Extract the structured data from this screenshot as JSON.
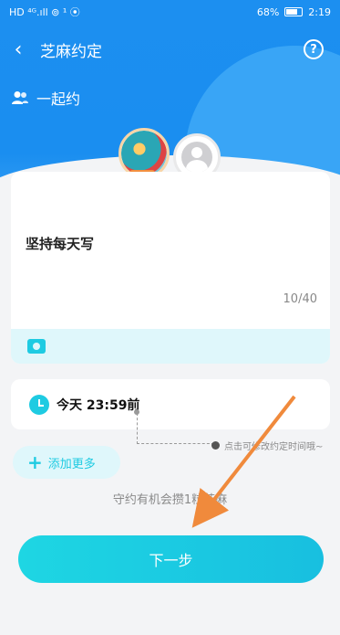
{
  "status_bar": {
    "left": "HD ⁴ᴳ.ıll ⊚ ¹ ⦿",
    "battery": "68%",
    "time": "2:19"
  },
  "header": {
    "title": "芝麻约定",
    "back_icon": "‹",
    "help_icon": "?"
  },
  "subtitle": {
    "label": "一起约"
  },
  "appointment": {
    "content": "坚持每天写",
    "counter": "10/40"
  },
  "deadline": {
    "label": "今天  23:59前"
  },
  "hint": {
    "text": "点击可修改约定时间哦~"
  },
  "add_more": {
    "label": "添加更多"
  },
  "reward": {
    "text": "守约有机会攒1粒芝麻"
  },
  "next_button": {
    "label": "下一步"
  },
  "colors": {
    "header_blue": "#1a8ef0",
    "accent_cyan": "#1ecbe2",
    "annotation_arrow": "#f08a3c"
  }
}
